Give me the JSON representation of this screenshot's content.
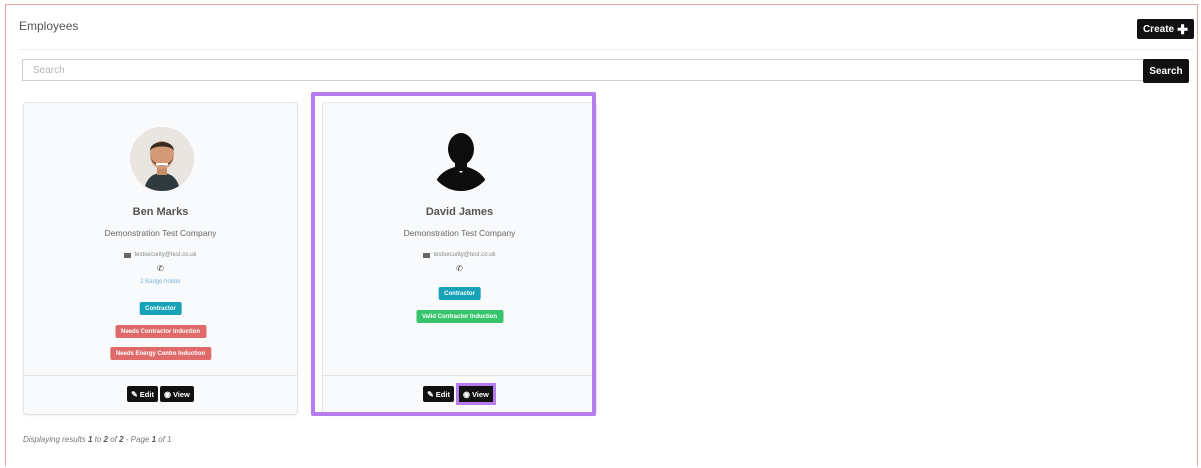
{
  "panel": {
    "title": "Employees",
    "create_label": "Create"
  },
  "search": {
    "placeholder": "Search",
    "button_label": "Search"
  },
  "employees": [
    {
      "name": "Ben Marks",
      "company": "Demonstration Test Company",
      "email": "testsecurity@test.co.uk",
      "badge_link": "2 Badge holder",
      "tags": [
        "Contractor",
        "Needs Contractor Induction",
        "Needs Energy Centre Induction"
      ],
      "edit_label": "Edit",
      "view_label": "View"
    },
    {
      "name": "David James",
      "company": "Demonstration Test Company",
      "email": "testsecurity@test.co.uk",
      "tags": [
        "Contractor",
        "Valid Contractor Induction"
      ],
      "edit_label": "Edit",
      "view_label": "View"
    }
  ],
  "pagination": {
    "prefix": "Displaying results",
    "from": "1",
    "to": "2",
    "total": "2",
    "page": "1",
    "pages": "1"
  },
  "colors": {
    "highlight": "#b67cf0",
    "tag_teal": "#17a2b8",
    "tag_red": "#e06a6a",
    "tag_green": "#36c46a"
  }
}
